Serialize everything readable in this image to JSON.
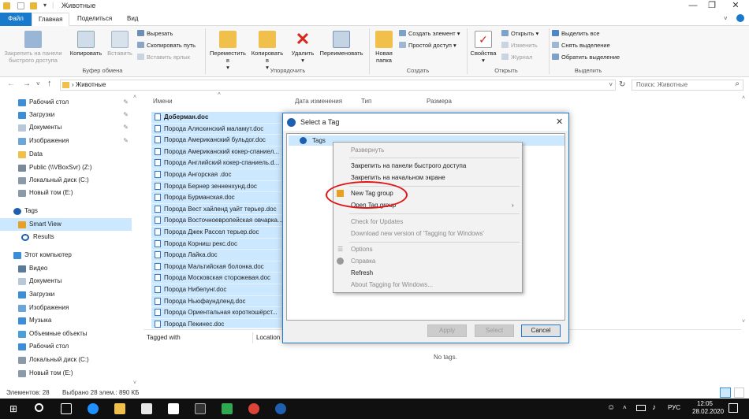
{
  "window": {
    "title": "Животные",
    "minimize": "—",
    "maximize": "❐",
    "close": "✕"
  },
  "menu": {
    "tabs": [
      "Файл",
      "Главная",
      "Поделиться",
      "Вид"
    ]
  },
  "ribbon": {
    "pin": "Закрепить на панели быстрого доступа",
    "copy": "Копировать",
    "paste": "Вставить",
    "cut": "Вырезать",
    "copy_path": "Скопировать путь",
    "paste_shortcut": "Вставить ярлык",
    "group_clipboard": "Буфер обмена",
    "move_to": "Переместить в",
    "copy_to": "Копировать в",
    "delete": "Удалить",
    "rename": "Переименовать",
    "group_organize": "Упорядочить",
    "new_folder": "Новая папка",
    "new_item": "Создать элемент",
    "easy_access": "Простой доступ",
    "group_create": "Создать",
    "properties": "Свойства",
    "open": "Открыть",
    "edit": "Изменить",
    "history": "Журнал",
    "group_open": "Открыть",
    "select_all": "Выделить все",
    "select_none": "Снять выделение",
    "invert": "Обратить выделение",
    "group_select": "Выделить"
  },
  "address": {
    "path": "Животные",
    "search_placeholder": "Поиск: Животные"
  },
  "nav": {
    "items": [
      {
        "label": "Рабочий стол",
        "pinned": true
      },
      {
        "label": "Загрузки",
        "pinned": true
      },
      {
        "label": "Документы",
        "pinned": true
      },
      {
        "label": "Изображения",
        "pinned": true
      },
      {
        "label": "Data"
      },
      {
        "label": "Public (\\\\VBoxSvr) (Z:)"
      },
      {
        "label": "Локальный диск (C:)"
      },
      {
        "label": "Новый том (E:)"
      },
      {
        "label": "Tags"
      },
      {
        "label": "Smart View"
      },
      {
        "label": "Results"
      },
      {
        "label": "Этот компьютер"
      },
      {
        "label": "Видео"
      },
      {
        "label": "Документы"
      },
      {
        "label": "Загрузки"
      },
      {
        "label": "Изображения"
      },
      {
        "label": "Музыка"
      },
      {
        "label": "Объемные объекты"
      },
      {
        "label": "Рабочий стол"
      },
      {
        "label": "Локальный диск (C:)"
      },
      {
        "label": "Новый том (E:)"
      }
    ]
  },
  "columns": [
    "Имени",
    "Дата изменения",
    "Тип",
    "Размера"
  ],
  "files": [
    "Доберман.doc",
    "Порода Аляскинский маламут.doc",
    "Порода Американский бульдог.doc",
    "Порода Американский кокер-спаниел...",
    "Порода Английский кокер-спаниель.d...",
    "Порода Ангорская  .doc",
    "Порода Бернер зенненхунд.doc",
    "Порода Бурманская.doc",
    "Порода Вест хайленд уайт терьер.doc",
    "Порода Восточноевропейская овчарка...",
    "Порода Джек Рассел терьер.doc",
    "Порода Корниш рекс.doc",
    "Порода Лайка.doc",
    "Порода Мальтийская болонка.doc",
    "Порода Московская сторожевая.doc",
    "Порода Нибелунг.doc",
    "Порода Ньюфаундленд.doc",
    "Порода Ориентальная короткошёрст...",
    "Порода Пекинес.doc"
  ],
  "detail": {
    "tagged_with": "Tagged with",
    "location": "Location",
    "no_tags": "No tags."
  },
  "status": {
    "count": "Элементов: 28",
    "selected": "Выбрано 28 элем.: 890 КБ"
  },
  "taskbar": {
    "lang": "РУС",
    "time": "12:05",
    "date": "28.02.2020"
  },
  "dialog": {
    "title": "Select a Tag",
    "root": "Tags",
    "apply": "Apply",
    "select": "Select",
    "cancel": "Cancel"
  },
  "context": {
    "expand": "Развернуть",
    "pin_quick": "Закрепить на панели быстрого доступа",
    "pin_start": "Закрепить на начальном экране",
    "new_group": "New Tag group",
    "open_group": "Open Tag group",
    "check_updates": "Check for Updates",
    "download": "Download new version of 'Tagging for Windows'",
    "options": "Options",
    "help": "Справка",
    "refresh": "Refresh",
    "about": "About Tagging for Windows..."
  },
  "colors": {
    "accent": "#1979ca",
    "selection": "#cce8ff",
    "highlight": "#e01414"
  }
}
